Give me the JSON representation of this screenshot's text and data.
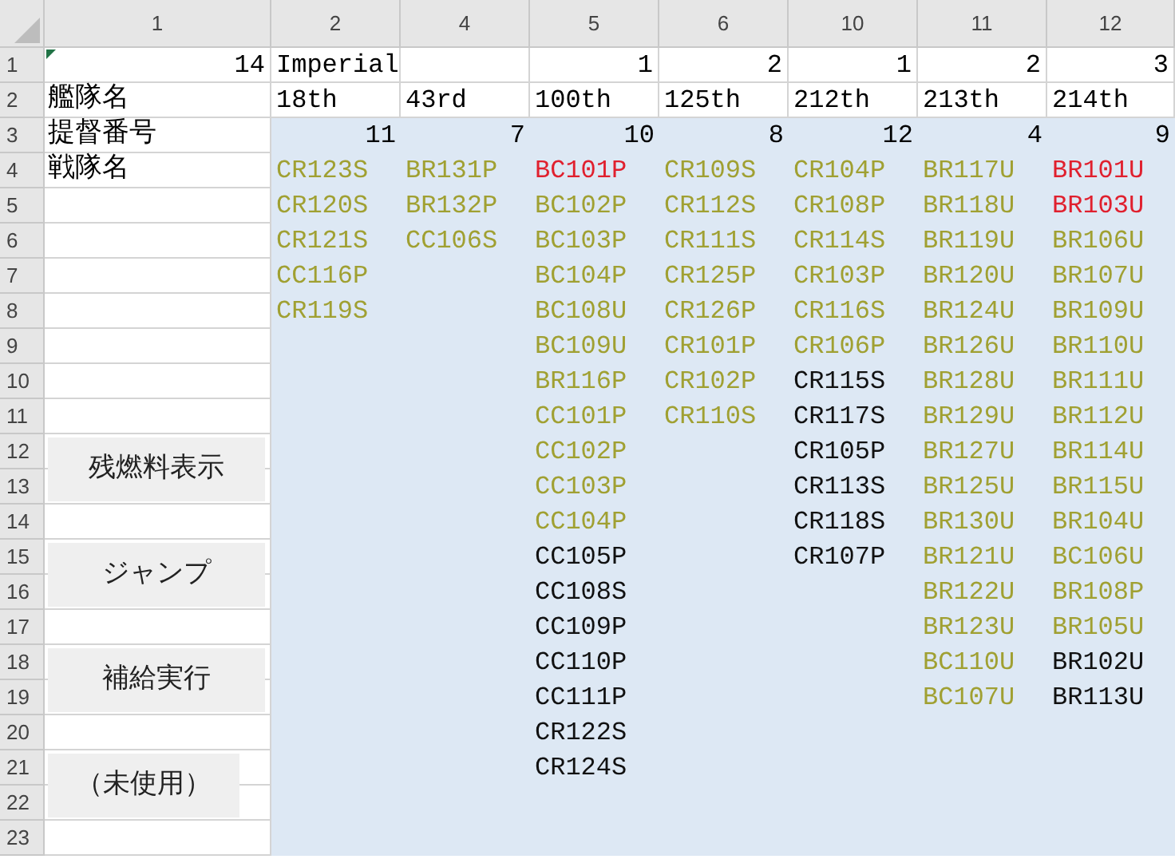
{
  "column_headers": [
    "1",
    "2",
    "4",
    "5",
    "6",
    "10",
    "11",
    "12"
  ],
  "row_headers": [
    "1",
    "2",
    "3",
    "4",
    "5",
    "6",
    "7",
    "8",
    "9",
    "10",
    "11",
    "12",
    "13",
    "14",
    "15",
    "16",
    "17",
    "18",
    "19",
    "20",
    "21",
    "22",
    "23"
  ],
  "corner_value": "14",
  "title": "Imperial",
  "row_labels": [
    "艦隊名",
    "提督番号",
    "戦隊名"
  ],
  "fleets": [
    {
      "name": "18th",
      "admiral": "11",
      "units": [
        {
          "code": "CR123S",
          "color": "#a0a032"
        },
        {
          "code": "CR120S",
          "color": "#a0a032"
        },
        {
          "code": "CR121S",
          "color": "#a0a032"
        },
        {
          "code": "CC116P",
          "color": "#a0a032"
        },
        {
          "code": "CR119S",
          "color": "#a0a032"
        }
      ]
    },
    {
      "name": "43rd",
      "admiral": "7",
      "units": [
        {
          "code": "BR131P",
          "color": "#a0a032"
        },
        {
          "code": "BR132P",
          "color": "#a0a032"
        },
        {
          "code": "CC106S",
          "color": "#a0a032"
        }
      ]
    },
    {
      "number": "1",
      "name": "100th",
      "admiral": "10",
      "units": [
        {
          "code": "BC101P",
          "color": "#e0202e"
        },
        {
          "code": "BC102P",
          "color": "#a0a032"
        },
        {
          "code": "BC103P",
          "color": "#a0a032"
        },
        {
          "code": "BC104P",
          "color": "#a0a032"
        },
        {
          "code": "BC108U",
          "color": "#a0a032"
        },
        {
          "code": "BC109U",
          "color": "#a0a032"
        },
        {
          "code": "BR116P",
          "color": "#a0a032"
        },
        {
          "code": "CC101P",
          "color": "#a0a032"
        },
        {
          "code": "CC102P",
          "color": "#a0a032"
        },
        {
          "code": "CC103P",
          "color": "#a0a032"
        },
        {
          "code": "CC104P",
          "color": "#a0a032"
        },
        {
          "code": "CC105P",
          "color": "#111111"
        },
        {
          "code": "CC108S",
          "color": "#111111"
        },
        {
          "code": "CC109P",
          "color": "#111111"
        },
        {
          "code": "CC110P",
          "color": "#111111"
        },
        {
          "code": "CC111P",
          "color": "#111111"
        },
        {
          "code": "CR122S",
          "color": "#111111"
        },
        {
          "code": "CR124S",
          "color": "#111111"
        }
      ]
    },
    {
      "number": "2",
      "name": "125th",
      "admiral": "8",
      "units": [
        {
          "code": "CR109S",
          "color": "#a0a032"
        },
        {
          "code": "CR112S",
          "color": "#a0a032"
        },
        {
          "code": "CR111S",
          "color": "#a0a032"
        },
        {
          "code": "CR125P",
          "color": "#a0a032"
        },
        {
          "code": "CR126P",
          "color": "#a0a032"
        },
        {
          "code": "CR101P",
          "color": "#a0a032"
        },
        {
          "code": "CR102P",
          "color": "#a0a032"
        },
        {
          "code": "CR110S",
          "color": "#a0a032"
        }
      ]
    },
    {
      "number": "1",
      "name": "212th",
      "admiral": "12",
      "units": [
        {
          "code": "CR104P",
          "color": "#a0a032"
        },
        {
          "code": "CR108P",
          "color": "#a0a032"
        },
        {
          "code": "CR114S",
          "color": "#a0a032"
        },
        {
          "code": "CR103P",
          "color": "#a0a032"
        },
        {
          "code": "CR116S",
          "color": "#a0a032"
        },
        {
          "code": "CR106P",
          "color": "#a0a032"
        },
        {
          "code": "CR115S",
          "color": "#111111"
        },
        {
          "code": "CR117S",
          "color": "#111111"
        },
        {
          "code": "CR105P",
          "color": "#111111"
        },
        {
          "code": "CR113S",
          "color": "#111111"
        },
        {
          "code": "CR118S",
          "color": "#111111"
        },
        {
          "code": "CR107P",
          "color": "#111111"
        }
      ]
    },
    {
      "number": "2",
      "name": "213th",
      "admiral": "4",
      "units": [
        {
          "code": "BR117U",
          "color": "#a0a032"
        },
        {
          "code": "BR118U",
          "color": "#a0a032"
        },
        {
          "code": "BR119U",
          "color": "#a0a032"
        },
        {
          "code": "BR120U",
          "color": "#a0a032"
        },
        {
          "code": "BR124U",
          "color": "#a0a032"
        },
        {
          "code": "BR126U",
          "color": "#a0a032"
        },
        {
          "code": "BR128U",
          "color": "#a0a032"
        },
        {
          "code": "BR129U",
          "color": "#a0a032"
        },
        {
          "code": "BR127U",
          "color": "#a0a032"
        },
        {
          "code": "BR125U",
          "color": "#a0a032"
        },
        {
          "code": "BR130U",
          "color": "#a0a032"
        },
        {
          "code": "BR121U",
          "color": "#a0a032"
        },
        {
          "code": "BR122U",
          "color": "#a0a032"
        },
        {
          "code": "BR123U",
          "color": "#a0a032"
        },
        {
          "code": "BC110U",
          "color": "#a0a032"
        },
        {
          "code": "BC107U",
          "color": "#a0a032"
        }
      ]
    },
    {
      "number": "3",
      "name": "214th",
      "admiral": "9",
      "units": [
        {
          "code": "BR101U",
          "color": "#e0202e"
        },
        {
          "code": "BR103U",
          "color": "#e0202e"
        },
        {
          "code": "BR106U",
          "color": "#a0a032"
        },
        {
          "code": "BR107U",
          "color": "#a0a032"
        },
        {
          "code": "BR109U",
          "color": "#a0a032"
        },
        {
          "code": "BR110U",
          "color": "#a0a032"
        },
        {
          "code": "BR111U",
          "color": "#a0a032"
        },
        {
          "code": "BR112U",
          "color": "#a0a032"
        },
        {
          "code": "BR114U",
          "color": "#a0a032"
        },
        {
          "code": "BR115U",
          "color": "#a0a032"
        },
        {
          "code": "BR104U",
          "color": "#a0a032"
        },
        {
          "code": "BC106U",
          "color": "#a0a032"
        },
        {
          "code": "BR108P",
          "color": "#a0a032"
        },
        {
          "code": "BR105U",
          "color": "#a0a032"
        },
        {
          "code": "BR102U",
          "color": "#111111"
        },
        {
          "code": "BR113U",
          "color": "#111111"
        }
      ]
    }
  ],
  "buttons": [
    "残燃料表示",
    "ジャンプ",
    "補給実行",
    "（未使用）"
  ]
}
